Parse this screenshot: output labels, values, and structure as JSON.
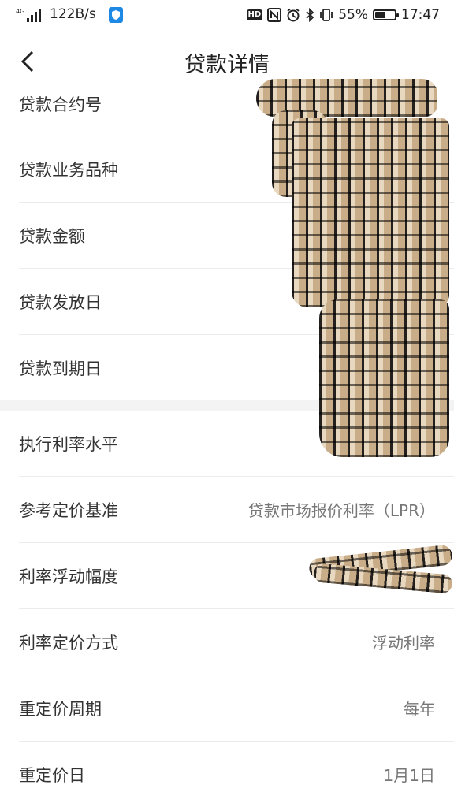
{
  "status_bar": {
    "network_type": "4G",
    "speed": "122B/s",
    "battery_percent": "55%",
    "battery_level": 0.55,
    "time": "17:47",
    "icons": [
      "signal-icon",
      "shield-app-icon",
      "hd-icon",
      "nfc-icon",
      "alarm-icon",
      "bluetooth-icon",
      "vibrate-icon",
      "battery-icon"
    ]
  },
  "nav": {
    "title": "贷款详情",
    "back_icon": "chevron-left-icon"
  },
  "details": {
    "section1": [
      {
        "label": "贷款合约号",
        "value": ""
      },
      {
        "label": "贷款业务品种",
        "value": ""
      },
      {
        "label": "贷款金额",
        "value": ""
      },
      {
        "label": "贷款发放日",
        "value": ""
      },
      {
        "label": "贷款到期日",
        "value": ""
      }
    ],
    "section2": [
      {
        "label": "执行利率水平",
        "value": ""
      },
      {
        "label": "参考定价基准",
        "value": "贷款市场报价利率（LPR）"
      },
      {
        "label": "利率浮动幅度",
        "value": ""
      },
      {
        "label": "利率定价方式",
        "value": "浮动利率"
      },
      {
        "label": "重定价周期",
        "value": "每年"
      },
      {
        "label": "重定价日",
        "value": "1月1日"
      }
    ]
  },
  "colors": {
    "background": "#ffffff",
    "divider": "#ececec",
    "label": "#333333",
    "value": "#777777",
    "redaction": "#d9c3a4"
  }
}
